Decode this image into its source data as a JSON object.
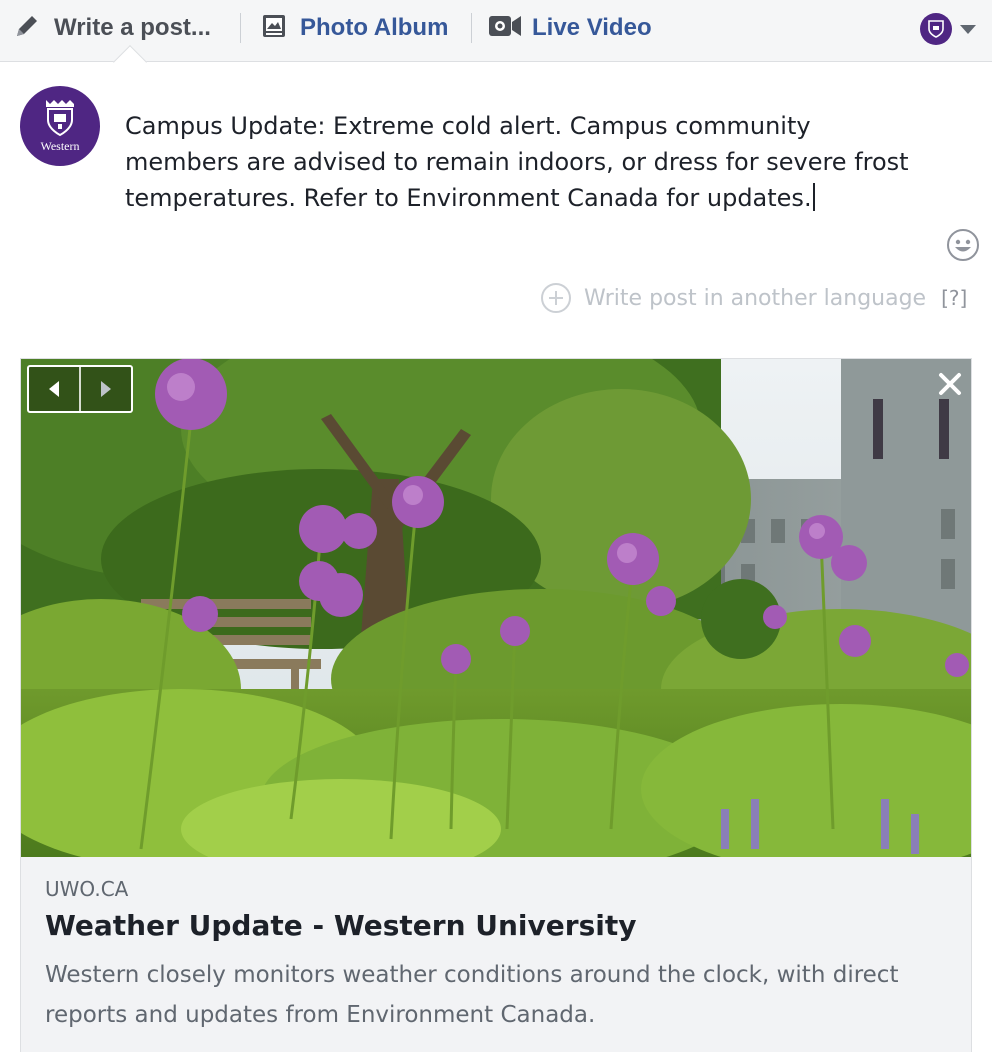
{
  "composer_tabs": {
    "write_post": {
      "label": "Write a post...",
      "icon": "pencil-icon"
    },
    "photo_album": {
      "label": "Photo Album",
      "icon": "photo-album-icon"
    },
    "live_video": {
      "label": "Live Video",
      "icon": "video-camera-icon"
    }
  },
  "page_identity": {
    "avatar_text": "Western",
    "brand_color": "#4f2683"
  },
  "post": {
    "text": "Campus Update: Extreme cold alert. Campus community members are advised to remain indoors, or dress for severe frost temperatures. Refer to Environment Canada for updates."
  },
  "language": {
    "label": "Write post in another language",
    "help": "[?]"
  },
  "link_preview": {
    "domain": "UWO.CA",
    "title": "Weather Update - Western University",
    "description": "Western closely monitors weather conditions around the clock, with direct reports and updates from Environment Canada."
  },
  "colors": {
    "link_blue": "#365899",
    "muted_text": "#606770",
    "placeholder_gray": "#bec3c9"
  }
}
